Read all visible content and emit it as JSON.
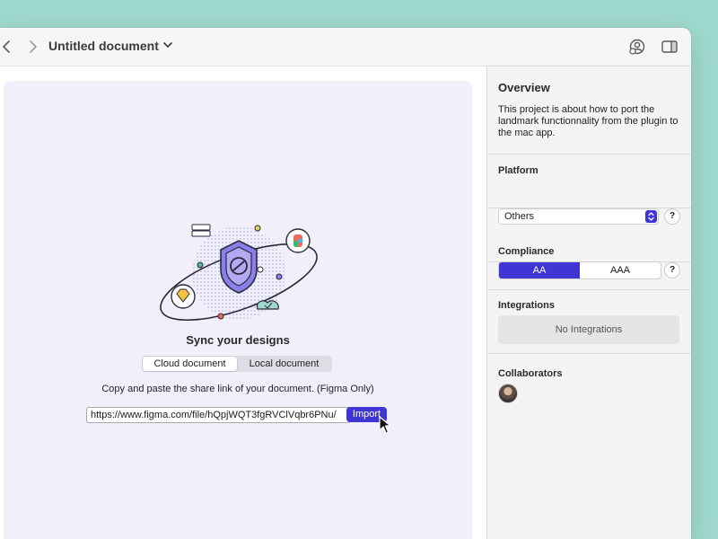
{
  "toolbar": {
    "document_title": "Untitled document"
  },
  "main": {
    "sync_title": "Sync your designs",
    "tabs": [
      {
        "label": "Cloud document",
        "active": true
      },
      {
        "label": "Local document",
        "active": false
      }
    ],
    "instruction": "Copy and paste the share link of your document. (Figma Only)",
    "url_value": "https://www.figma.com/file/hQpjWQT3fgRVClVqbr6PNu/",
    "import_label": "Import"
  },
  "sidebar": {
    "overview": {
      "title": "Overview",
      "text": "This project is about how to port the landmark functionnality from the plugin to the mac app."
    },
    "platform": {
      "title": "Platform",
      "selected": "Others",
      "help": "?"
    },
    "compliance": {
      "title": "Compliance",
      "options": [
        "AA",
        "AAA"
      ],
      "selected": "AA",
      "help": "?"
    },
    "integrations": {
      "title": "Integrations",
      "empty_text": "No Integrations"
    },
    "collaborators": {
      "title": "Collaborators"
    }
  },
  "colors": {
    "accent": "#3f35d4",
    "background": "#9fd8cd",
    "canvas": "#f0effa"
  }
}
